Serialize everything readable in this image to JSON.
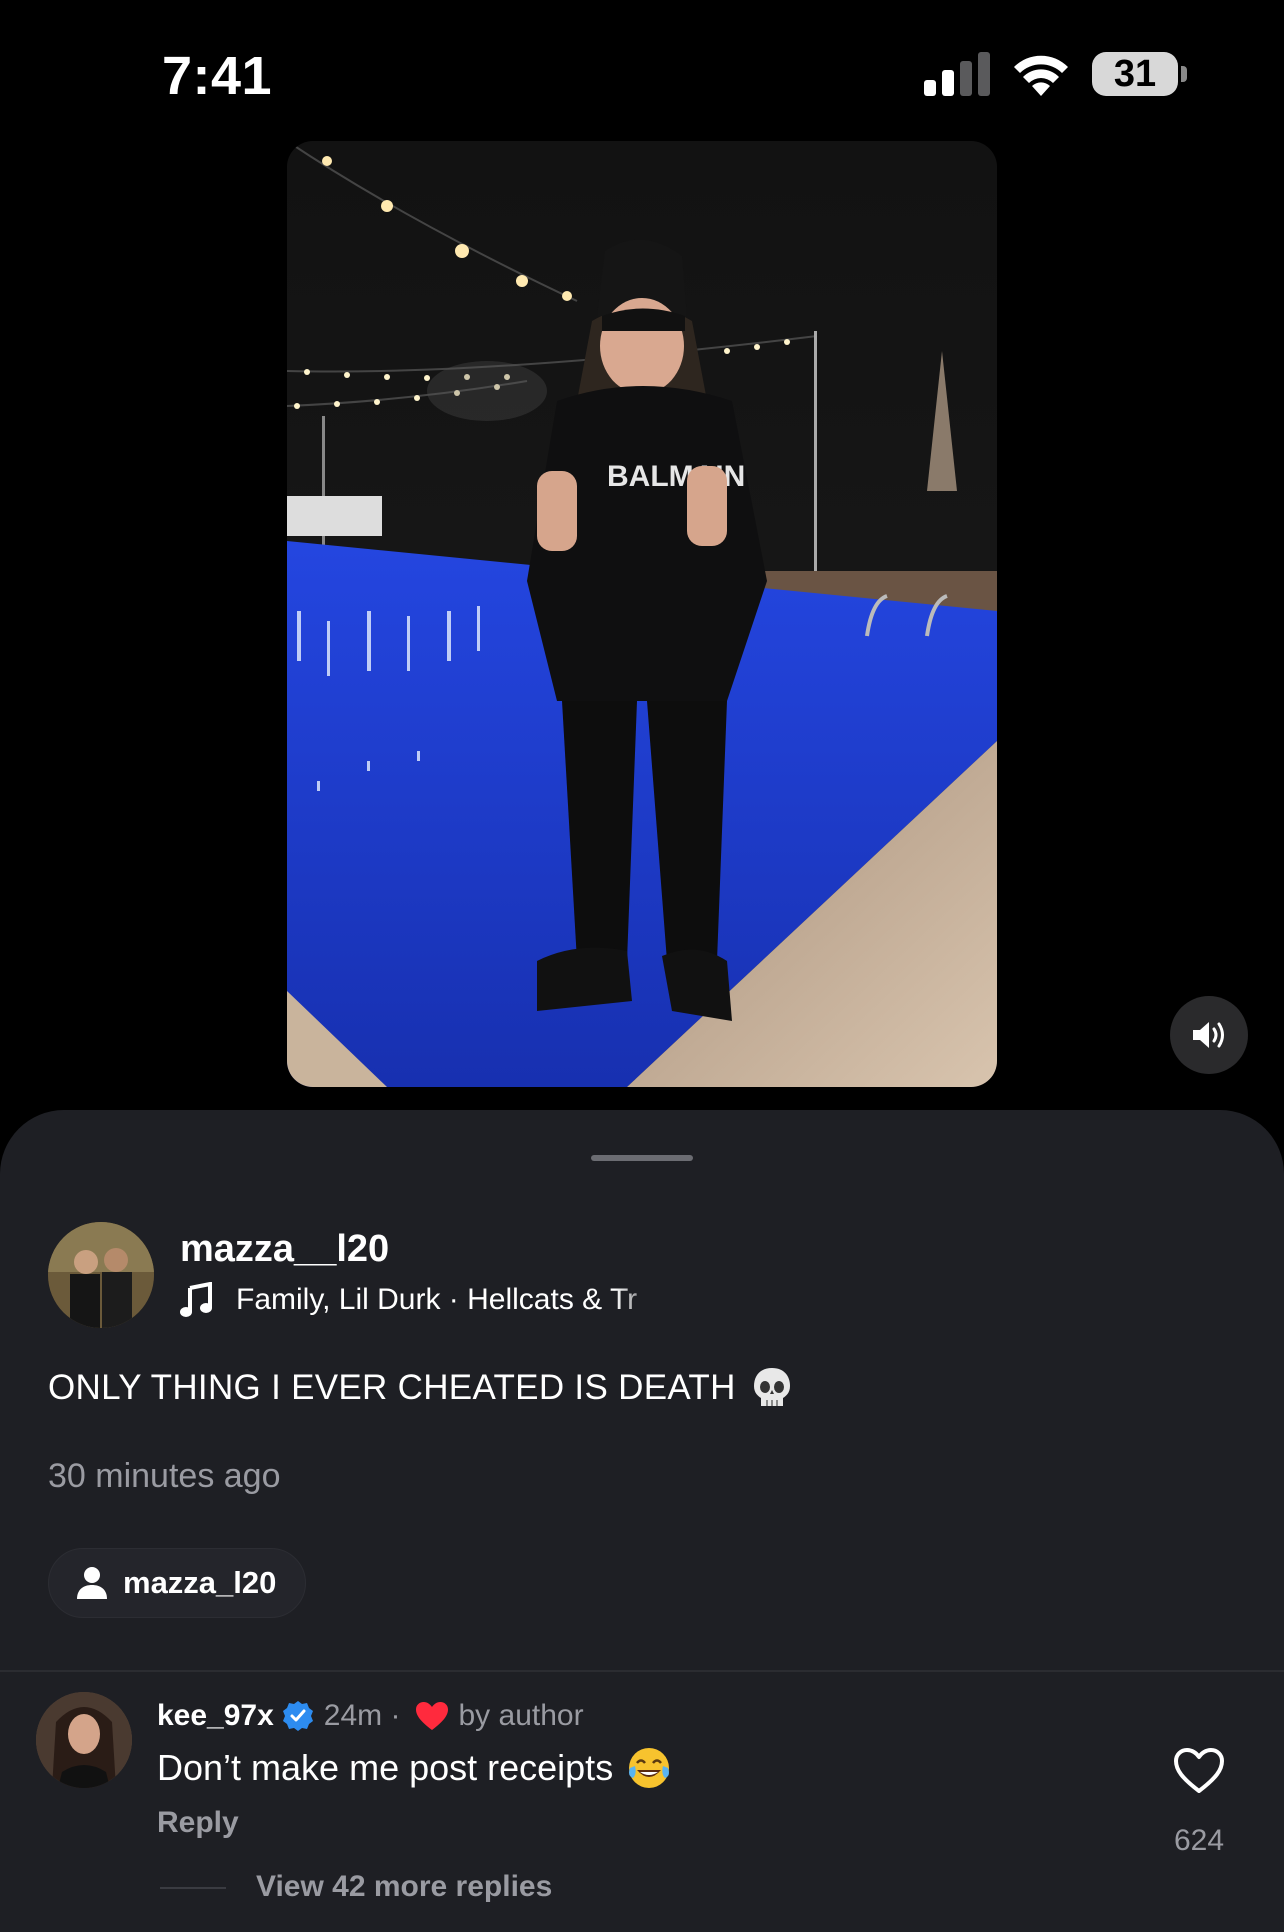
{
  "status_bar": {
    "time": "7:41",
    "battery_level": "31"
  },
  "media": {
    "description_icon": "video-thumbnail",
    "sound_icon": "speaker-on-icon"
  },
  "post": {
    "author": "mazza__l20",
    "music": "Family, Lil Durk · Hellcats & Tr",
    "caption": "ONLY THING I EVER CHEATED IS DEATH",
    "caption_emoji": "skull",
    "time_ago": "30 minutes ago",
    "tagged_user": "mazza_l20"
  },
  "comment": {
    "username": "kee_97x",
    "verified": true,
    "age": "24m ·",
    "liked_by": "by author",
    "text": "Don’t make me post receipts",
    "text_emoji": "tears-of-joy",
    "reply_label": "Reply",
    "like_count": "624",
    "view_replies": "View 42 more replies"
  },
  "colors": {
    "sheet_bg": "#1e1f24",
    "muted_text": "#9a9ba2",
    "verified_blue": "#2d8cf0",
    "heart_red": "#ff2a3d",
    "pool_blue": "#1e3fd4"
  }
}
